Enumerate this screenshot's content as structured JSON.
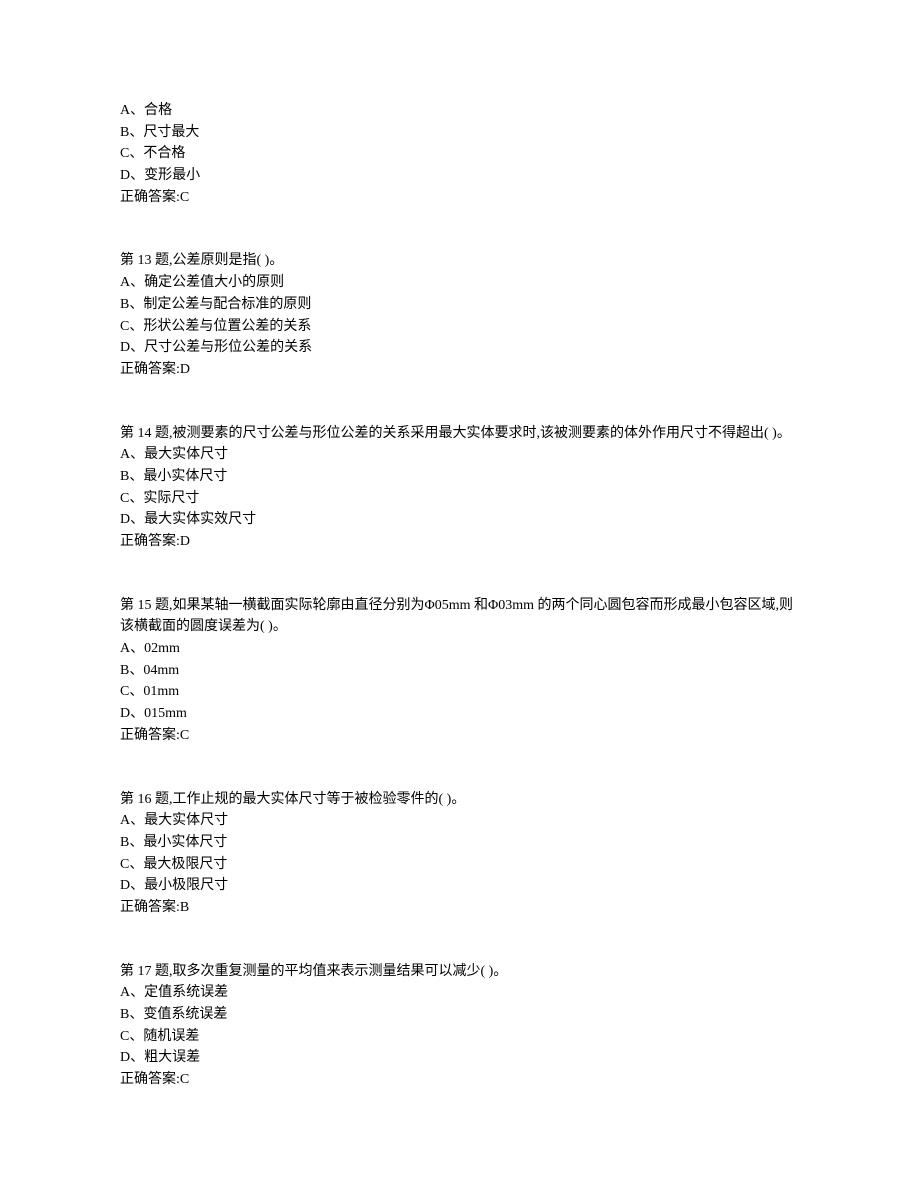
{
  "blocks": [
    {
      "lines": [
        "A、合格",
        "B、尺寸最大",
        "C、不合格",
        "D、变形最小",
        "正确答案:C"
      ]
    },
    {
      "lines": [
        "第 13 题,公差原则是指(  )。",
        "A、确定公差值大小的原则",
        "B、制定公差与配合标准的原则",
        "C、形状公差与位置公差的关系",
        "D、尺寸公差与形位公差的关系",
        "正确答案:D"
      ]
    },
    {
      "lines": [
        "第 14 题,被测要素的尺寸公差与形位公差的关系采用最大实体要求时,该被测要素的体外作用尺寸不得超出(  )。",
        "A、最大实体尺寸",
        "B、最小实体尺寸",
        "C、实际尺寸",
        "D、最大实体实效尺寸",
        "正确答案:D"
      ]
    },
    {
      "lines": [
        "第 15 题,如果某轴一横截面实际轮廓由直径分别为Φ05mm 和Φ03mm 的两个同心圆包容而形成最小包容区域,则该横截面的圆度误差为(  )。",
        "A、02mm",
        "B、04mm",
        "C、01mm",
        "D、015mm",
        "正确答案:C"
      ]
    },
    {
      "lines": [
        "第 16 题,工作止规的最大实体尺寸等于被检验零件的(  )。",
        "A、最大实体尺寸",
        "B、最小实体尺寸",
        "C、最大极限尺寸",
        "D、最小极限尺寸",
        "正确答案:B"
      ]
    },
    {
      "lines": [
        "第 17 题,取多次重复测量的平均值来表示测量结果可以减少(  )。",
        "A、定值系统误差",
        "B、变值系统误差",
        "C、随机误差",
        "D、粗大误差",
        "正确答案:C"
      ]
    }
  ]
}
